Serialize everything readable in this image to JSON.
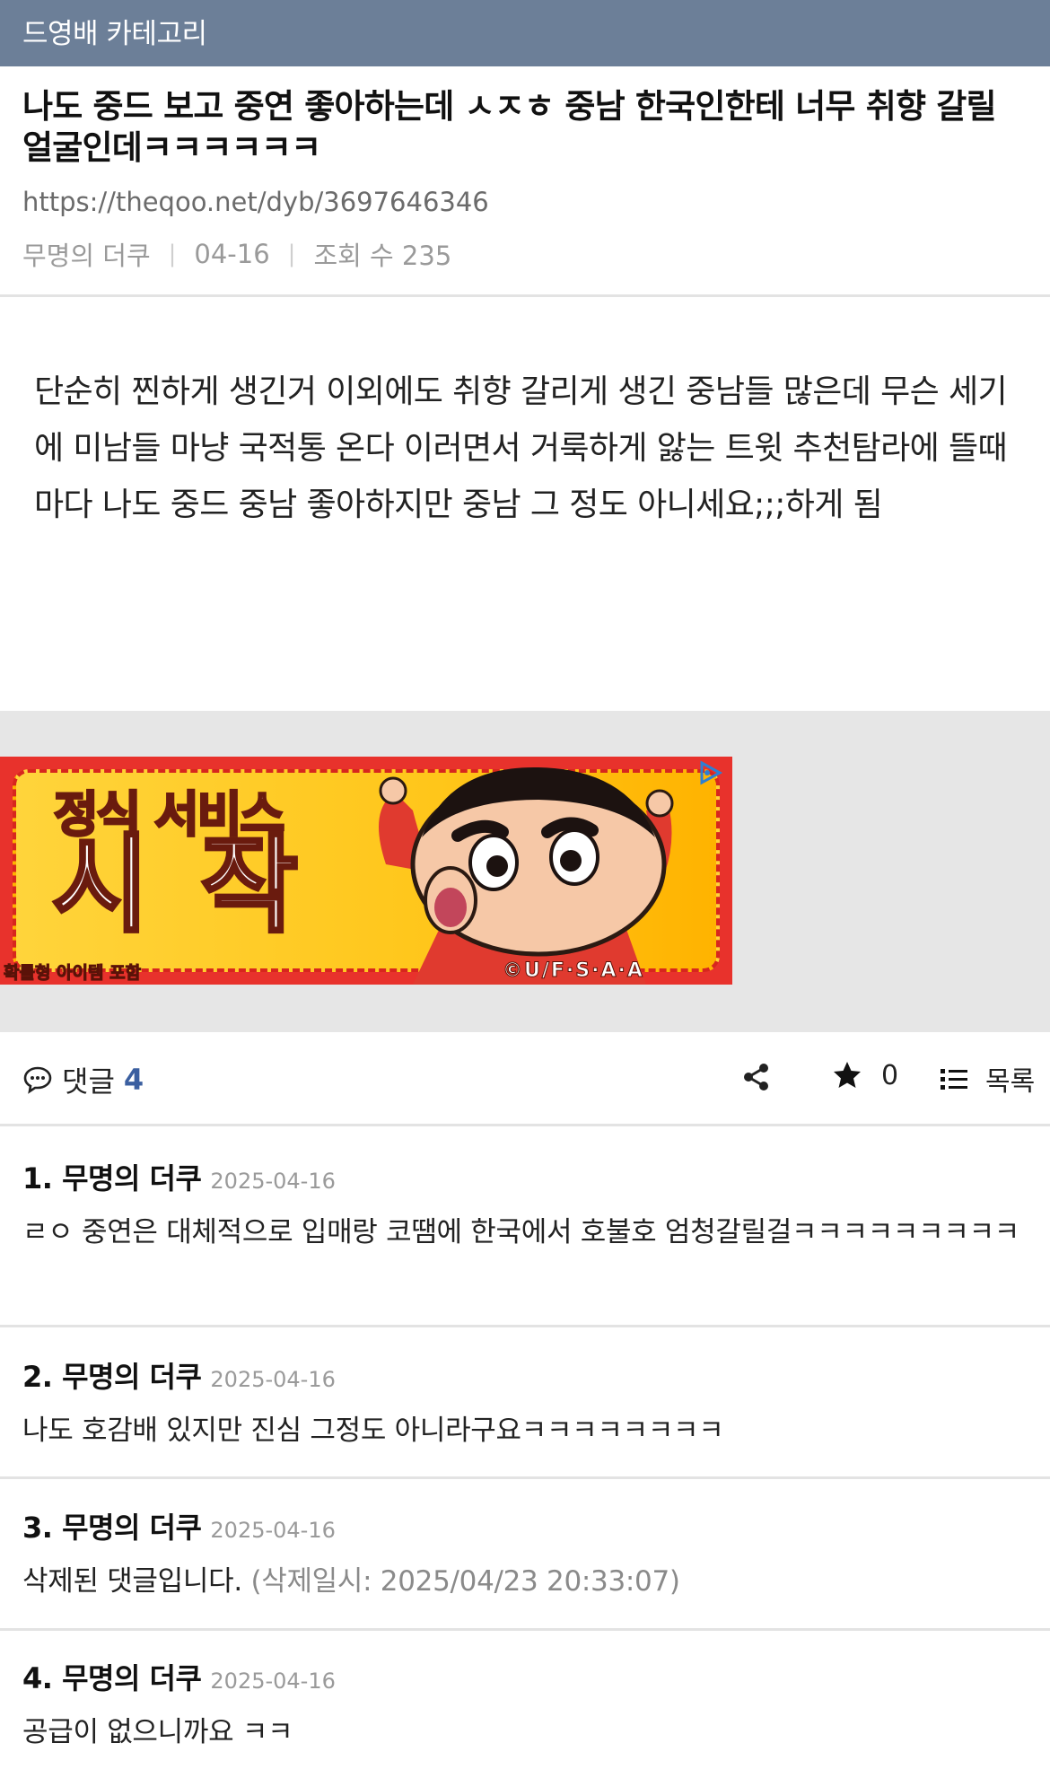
{
  "category": {
    "label": "드영배 카테고리"
  },
  "post": {
    "title": "나도 중드 보고 중연 좋아하는데 ㅅㅈㅎ 중남 한국인한테 너무 취향 갈릴 얼굴인데ㅋㅋㅋㅋㅋㅋ",
    "url": "https://theqoo.net/dyb/3697646346",
    "author": "무명의 더쿠",
    "date": "04-16",
    "views": "조회 수 235",
    "body": "단순히 찐하게 생긴거 이외에도 취향 갈리게 생긴 중남들 많은데 무슨 세기에 미남들 마냥 국적통 온다 이러면서 거룩하게 앓는 트윗 추천탐라에 뜰때마다 나도 중드 중남 좋아하지만 중남 그 정도 아니세요;;;하게 됨"
  },
  "ad": {
    "line1": "정식 서비스",
    "line2": "시 작",
    "note": "확률형 아이템 포함",
    "copyright": "©U/F·S·A·A"
  },
  "comment_bar": {
    "comments_label": "댓글",
    "comments_count": "4",
    "star_count": "0",
    "list_label": "목록"
  },
  "comments": [
    {
      "author": "1. 무명의 더쿠",
      "date": "2025-04-16",
      "text": "ㄹㅇ 중연은 대체적으로 입매랑 코땜에 한국에서 호불호 엄청갈릴걸ㅋㅋㅋㅋㅋㅋㅋㅋㅋ"
    },
    {
      "author": "2. 무명의 더쿠",
      "date": "2025-04-16",
      "text": "나도 호감배 있지만 진심 그정도 아니라구요ㅋㅋㅋㅋㅋㅋㅋㅋ"
    },
    {
      "author": "3. 무명의 더쿠",
      "date": "2025-04-16",
      "text": "삭제된 댓글입니다.",
      "deleted_note": "(삭제일시: 2025/04/23 20:33:07)"
    },
    {
      "author": "4. 무명의 더쿠",
      "date": "2025-04-16",
      "text": "공급이 없으니까요 ㅋㅋ"
    }
  ]
}
